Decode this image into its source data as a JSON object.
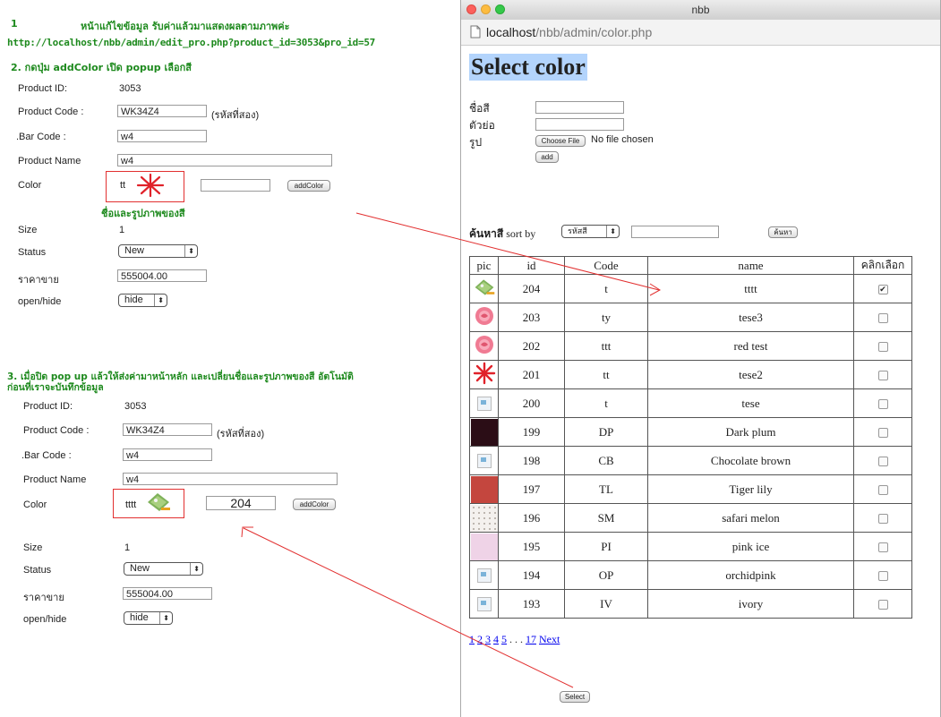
{
  "annotations": {
    "step1_num": "1",
    "step1_text": "หน้าแก้ไขข้อมูล รับค่าแล้วมาแสดงผลตามภาพค่ะ",
    "step1_url": "http://localhost/nbb/admin/edit_pro.php?product_id=3053&pro_id=57",
    "step2_text": "2. กดปุ่ม addColor เปิด popup เลือกสี",
    "step2_note": "ชื่อและรูปภาพของสี",
    "step3_line1": "3. เมื่อปิด pop up แล้วให้ส่งค่ามาหน้าหลัก และเปลี่ยนชื่อและรูปภาพของสี อัตโนมัติ",
    "step3_line2": "ก่อนที่เราจะบันทึกข้อมูล"
  },
  "form1": {
    "product_id_label": "Product ID:",
    "product_id_value": "3053",
    "product_code_label": "Product Code :",
    "product_code_value": "WK34Z4",
    "product_code_hint": "(รหัสที่สอง)",
    "bar_code_label": ".Bar Code :",
    "bar_code_value": "w4",
    "product_name_label": "Product Name",
    "product_name_value": "w4",
    "color_label": "Color",
    "color_name": "tt",
    "color_id": "",
    "add_color_label": "addColor",
    "size_label": "Size",
    "size_value": "1",
    "status_label": "Status",
    "status_value": "New",
    "price_label": "ราคาขาย",
    "price_value": "555004.00",
    "openhide_label": "open/hide",
    "openhide_value": "hide"
  },
  "form2": {
    "product_id_label": "Product ID:",
    "product_id_value": "3053",
    "product_code_label": "Product Code :",
    "product_code_value": "WK34Z4",
    "product_code_hint": "(รหัสที่สอง)",
    "bar_code_label": ".Bar Code :",
    "bar_code_value": "w4",
    "product_name_label": "Product Name",
    "product_name_value": "w4",
    "color_label": "Color",
    "color_name": "tttt",
    "color_id": "204",
    "add_color_label": "addColor",
    "size_label": "Size",
    "size_value": "1",
    "status_label": "Status",
    "status_value": "New",
    "price_label": "ราคาขาย",
    "price_value": "555004.00",
    "openhide_label": "open/hide",
    "openhide_value": "hide"
  },
  "popup": {
    "window_title": "nbb",
    "url_host": "localhost",
    "url_path": "/nbb/admin/color.php",
    "heading": "Select color",
    "name_label": "ชื่อสี",
    "abbr_label": "ตัวย่อ",
    "image_label": "รูป",
    "choose_file_label": "Choose File",
    "no_file_text": "No file chosen",
    "add_label": "add",
    "search_label": "ค้นหาสี",
    "sort_by_label": "sort by",
    "sort_value": "รหัสสี",
    "search_button_label": "ค้นหา",
    "columns": [
      "pic",
      "id",
      "Code",
      "name",
      "คลิกเลือก"
    ],
    "pagination_pages": [
      "1",
      "2",
      "3",
      "4",
      "5"
    ],
    "pagination_ellipsis": " . . .",
    "pagination_last": "17",
    "pagination_next": "Next",
    "select_button_label": "Select"
  },
  "colors": [
    {
      "id": "204",
      "code": "t",
      "name": "tttt",
      "pic": "swatch-pin",
      "checked": true
    },
    {
      "id": "203",
      "code": "ty",
      "name": "tese3",
      "pic": "rose",
      "checked": false
    },
    {
      "id": "202",
      "code": "ttt",
      "name": "red test",
      "pic": "rose",
      "checked": false
    },
    {
      "id": "201",
      "code": "tt",
      "name": "tese2",
      "pic": "asterisk",
      "checked": false
    },
    {
      "id": "200",
      "code": "t",
      "name": "tese",
      "pic": "broken-image",
      "checked": false
    },
    {
      "id": "199",
      "code": "DP",
      "name": "Dark plum",
      "pic": "#2b0d16",
      "checked": false
    },
    {
      "id": "198",
      "code": "CB",
      "name": "Chocolate brown",
      "pic": "broken-image",
      "checked": false
    },
    {
      "id": "197",
      "code": "TL",
      "name": "Tiger lily",
      "pic": "#c4463e",
      "checked": false
    },
    {
      "id": "196",
      "code": "SM",
      "name": "safari melon",
      "pic": "dots",
      "checked": false
    },
    {
      "id": "195",
      "code": "PI",
      "name": "pink ice",
      "pic": "#efd3e7",
      "checked": false
    },
    {
      "id": "194",
      "code": "OP",
      "name": "orchidpink",
      "pic": "broken-image",
      "checked": false
    },
    {
      "id": "193",
      "code": "IV",
      "name": "ivory",
      "pic": "broken-image",
      "checked": false
    }
  ]
}
